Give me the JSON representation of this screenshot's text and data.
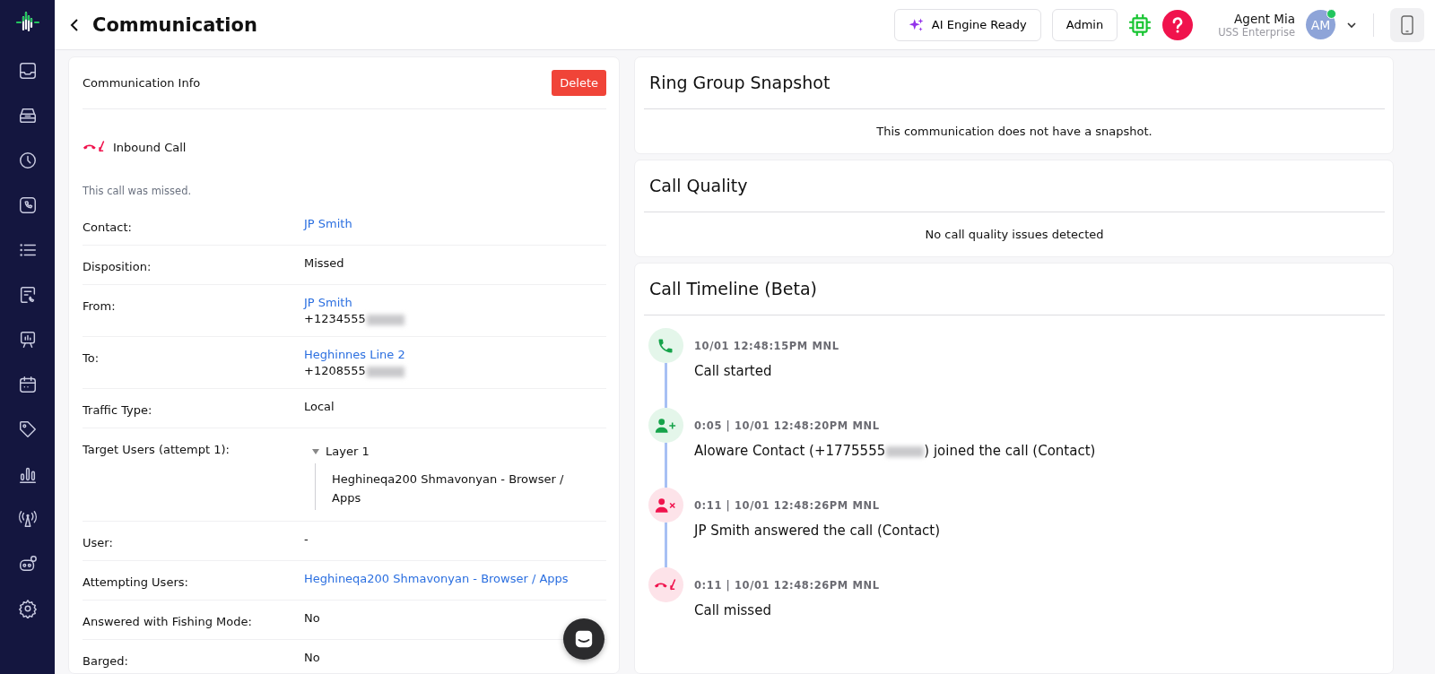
{
  "sidebar": {
    "items": [
      {
        "kind": "inbox"
      },
      {
        "kind": "stack"
      },
      {
        "kind": "clock"
      },
      {
        "kind": "phone"
      },
      {
        "kind": "list"
      },
      {
        "kind": "chat"
      },
      {
        "kind": "board"
      },
      {
        "kind": "calendar"
      },
      {
        "kind": "tag"
      },
      {
        "kind": "chart"
      },
      {
        "kind": "antenna"
      },
      {
        "kind": "robot"
      },
      {
        "kind": "gear"
      }
    ]
  },
  "header": {
    "title": "Communication",
    "ai_button": "AI Engine Ready",
    "role_button": "Admin",
    "user": {
      "name": "Agent Mia",
      "org": "USS Enterprise",
      "initials": "AM",
      "online": true
    }
  },
  "info": {
    "title": "Communication Info",
    "delete": "Delete",
    "call_type": "Inbound Call",
    "note": "This call was missed.",
    "rows": [
      {
        "label": "Contact:",
        "values": [
          {
            "kind": "link",
            "text": "JP Smith"
          }
        ]
      },
      {
        "label": "Disposition:",
        "values": [
          {
            "kind": "plain",
            "text": "Missed"
          }
        ]
      },
      {
        "label": "From:",
        "values": [
          {
            "kind": "link",
            "text": "JP Smith"
          },
          {
            "kind": "phone",
            "text": "+1234555"
          }
        ]
      },
      {
        "label": "To:",
        "values": [
          {
            "kind": "link",
            "text": "Heghinnes Line 2"
          },
          {
            "kind": "phone",
            "text": "+1208555"
          }
        ]
      },
      {
        "label": "Traffic Type:",
        "values": [
          {
            "kind": "plain",
            "text": "Local"
          }
        ]
      },
      {
        "label": "Target Users (attempt 1):",
        "tree": {
          "label": "Layer 1",
          "expanded": true,
          "children": [
            {
              "label": "Heghineqa200 Shmavonyan - Browser / Apps"
            }
          ]
        }
      },
      {
        "label": "User:",
        "values": [
          {
            "kind": "plain",
            "text": "-"
          }
        ]
      },
      {
        "label": "Attempting Users:",
        "values": [
          {
            "kind": "link",
            "text": "Heghineqa200 Shmavonyan - Browser / Apps"
          }
        ]
      },
      {
        "label": "Answered with Fishing Mode:",
        "values": [
          {
            "kind": "plain",
            "text": "No"
          }
        ]
      },
      {
        "label": "Barged:",
        "values": [
          {
            "kind": "plain",
            "text": "No"
          }
        ]
      }
    ]
  },
  "snapshot": {
    "title": "Ring Group Snapshot",
    "message": "This communication does not have a snapshot."
  },
  "quality": {
    "title": "Call Quality",
    "message": "No call quality issues detected"
  },
  "timeline": {
    "title": "Call Timeline (Beta)",
    "events": [
      {
        "kind": "call-start",
        "meta": "10/01 12:48:15PM MNL",
        "parts": [
          "Call started"
        ]
      },
      {
        "kind": "user-joined",
        "meta": "0:05 | 10/01 12:48:20PM MNL",
        "parts": [
          "Aloware Contact (+1775555",
          ") joined the call (Contact)"
        ]
      },
      {
        "kind": "user-left",
        "meta": "0:11 | 10/01 12:48:26PM MNL",
        "parts": [
          "JP Smith answered the call (Contact)"
        ]
      },
      {
        "kind": "call-missed",
        "meta": "0:11 | 10/01 12:48:26PM MNL",
        "parts": [
          "Call missed"
        ]
      }
    ]
  }
}
